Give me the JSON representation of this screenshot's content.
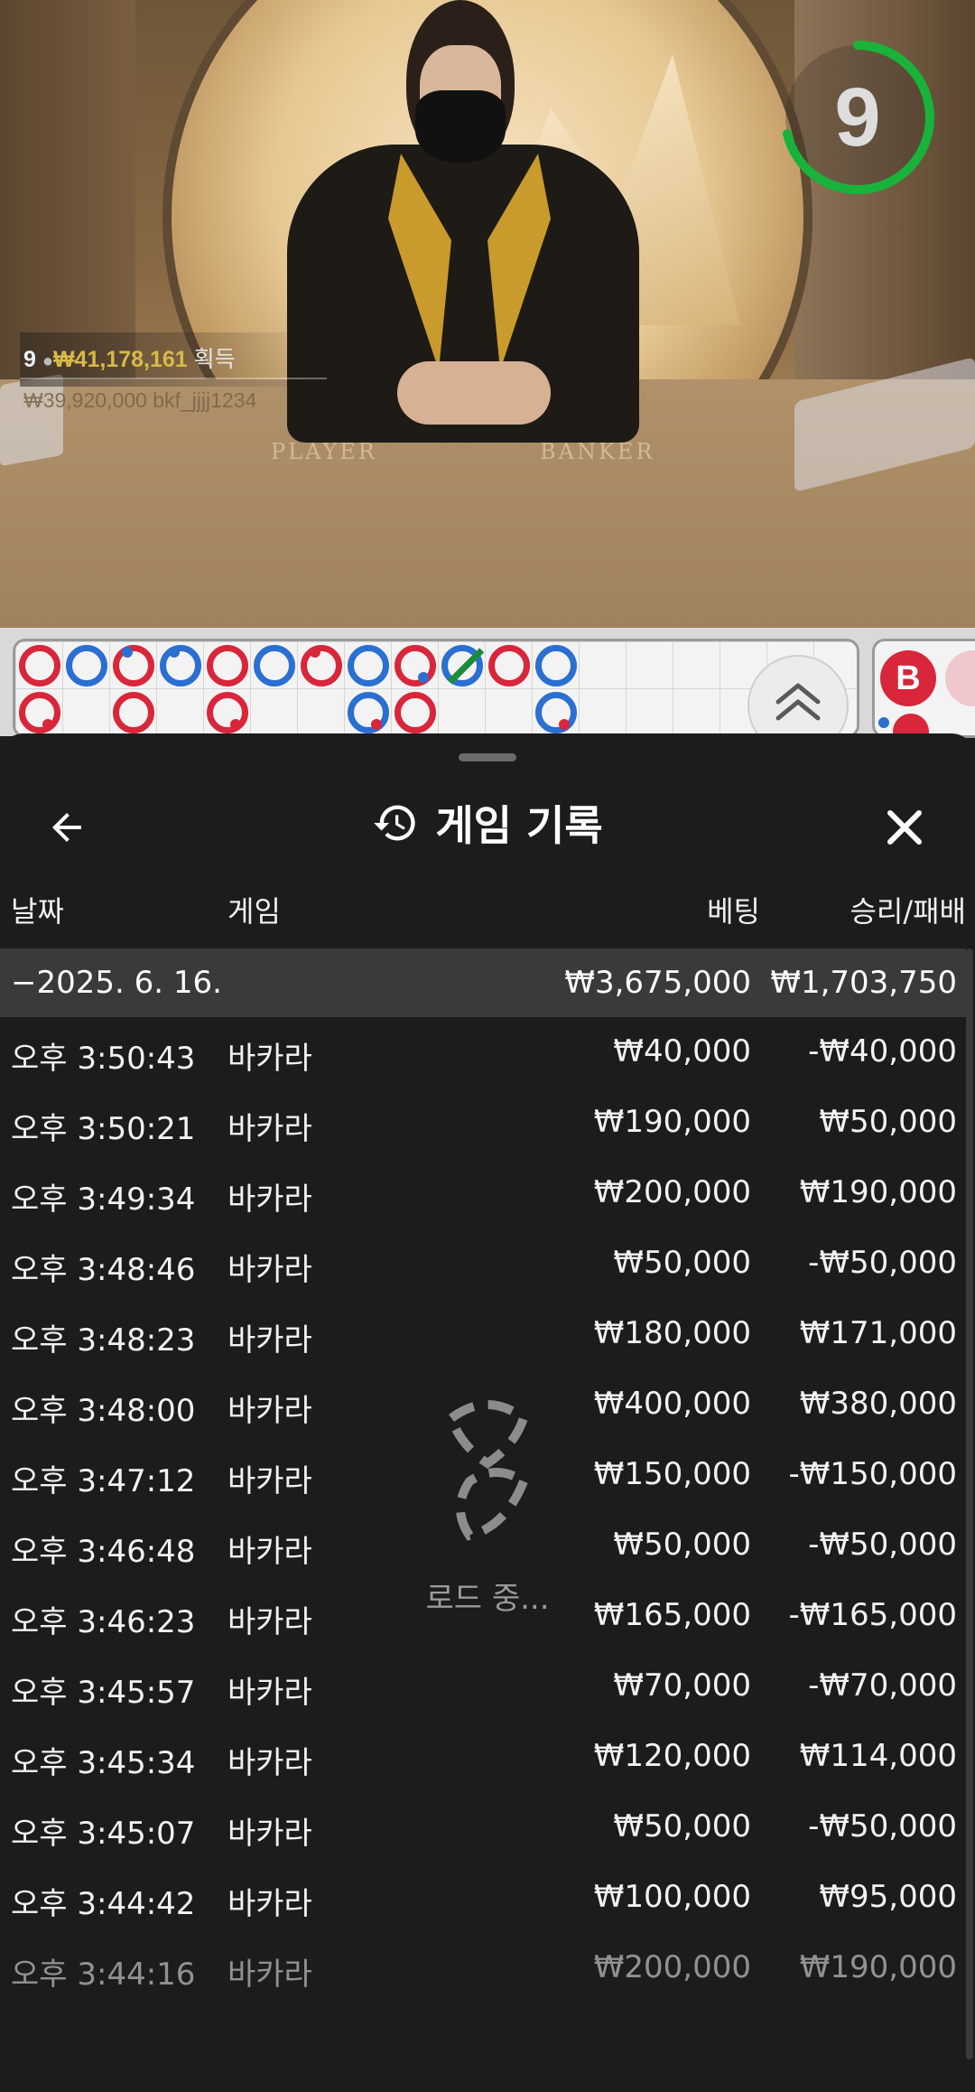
{
  "video": {
    "timer_value": "9",
    "win_banner": {
      "count": "9",
      "amount": "₩41,178,161",
      "label": "획득",
      "sub": "₩39,920,000 bkf_jjjj1234"
    },
    "felt_labels": {
      "player": "PLAYER",
      "banker": "BANKER"
    }
  },
  "road": {
    "badge": "B",
    "colors": {
      "banker": "#d8263a",
      "player": "#2a6fd1"
    }
  },
  "sheet": {
    "title": "게임 기록",
    "back_icon": "arrow-left-icon",
    "title_icon": "history-icon",
    "close_icon": "close-icon",
    "columns": {
      "date": "날짜",
      "game": "게임",
      "bet": "베팅",
      "winloss": "승리/패배"
    },
    "group": {
      "date": "−2025. 6. 16.",
      "bet": "₩3,675,000",
      "winloss": "₩1,703,750"
    },
    "rows": [
      {
        "time": "오후 3:50:43",
        "game": "바카라",
        "bet": "₩40,000",
        "result": "-₩40,000"
      },
      {
        "time": "오후 3:50:21",
        "game": "바카라",
        "bet": "₩190,000",
        "result": "₩50,000"
      },
      {
        "time": "오후 3:49:34",
        "game": "바카라",
        "bet": "₩200,000",
        "result": "₩190,000"
      },
      {
        "time": "오후 3:48:46",
        "game": "바카라",
        "bet": "₩50,000",
        "result": "-₩50,000"
      },
      {
        "time": "오후 3:48:23",
        "game": "바카라",
        "bet": "₩180,000",
        "result": "₩171,000"
      },
      {
        "time": "오후 3:48:00",
        "game": "바카라",
        "bet": "₩400,000",
        "result": "₩380,000"
      },
      {
        "time": "오후 3:47:12",
        "game": "바카라",
        "bet": "₩150,000",
        "result": "-₩150,000"
      },
      {
        "time": "오후 3:46:48",
        "game": "바카라",
        "bet": "₩50,000",
        "result": "-₩50,000"
      },
      {
        "time": "오후 3:46:23",
        "game": "바카라",
        "bet": "₩165,000",
        "result": "-₩165,000"
      },
      {
        "time": "오후 3:45:57",
        "game": "바카라",
        "bet": "₩70,000",
        "result": "-₩70,000"
      },
      {
        "time": "오후 3:45:34",
        "game": "바카라",
        "bet": "₩120,000",
        "result": "₩114,000"
      },
      {
        "time": "오후 3:45:07",
        "game": "바카라",
        "bet": "₩50,000",
        "result": "-₩50,000"
      },
      {
        "time": "오후 3:44:42",
        "game": "바카라",
        "bet": "₩100,000",
        "result": "₩95,000"
      },
      {
        "time": "오후 3:44:16",
        "game": "바카라",
        "bet": "₩200,000",
        "result": "₩190,000"
      }
    ],
    "loading_text": "로드 중..."
  }
}
